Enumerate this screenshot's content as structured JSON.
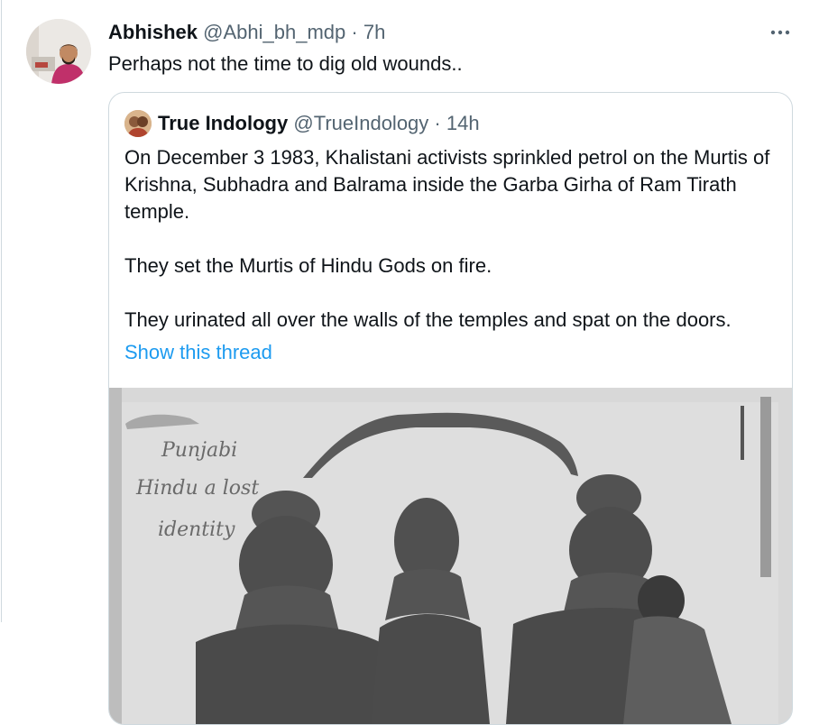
{
  "tweet": {
    "author_name": "Abhishek",
    "author_handle": "@Abhi_bh_mdp",
    "separator": "·",
    "time": "7h",
    "text": "Perhaps not the time to dig old wounds..",
    "avatar_icon": "user-avatar-photo",
    "more_icon": "more-options-icon"
  },
  "quote": {
    "author_name": "True Indology",
    "author_handle": "@TrueIndology",
    "separator": "·",
    "time": "14h",
    "paragraphs": [
      "On December 3 1983, Khalistani activists sprinkled petrol on the Murtis of Krishna, Subhadra and Balrama inside the Garba Girha of Ram Tirath temple.",
      "They set the Murtis  of Hindu Gods on fire.",
      "They urinated all over the walls of the temples and spat on the doors."
    ],
    "show_thread": "Show this thread",
    "media": {
      "overlay_lines": [
        "Punjabi",
        "Hindu a lost",
        "identity"
      ]
    }
  },
  "colors": {
    "text": "#0f1419",
    "muted": "#536471",
    "link": "#1d9bf0",
    "border": "#cfd9de"
  }
}
